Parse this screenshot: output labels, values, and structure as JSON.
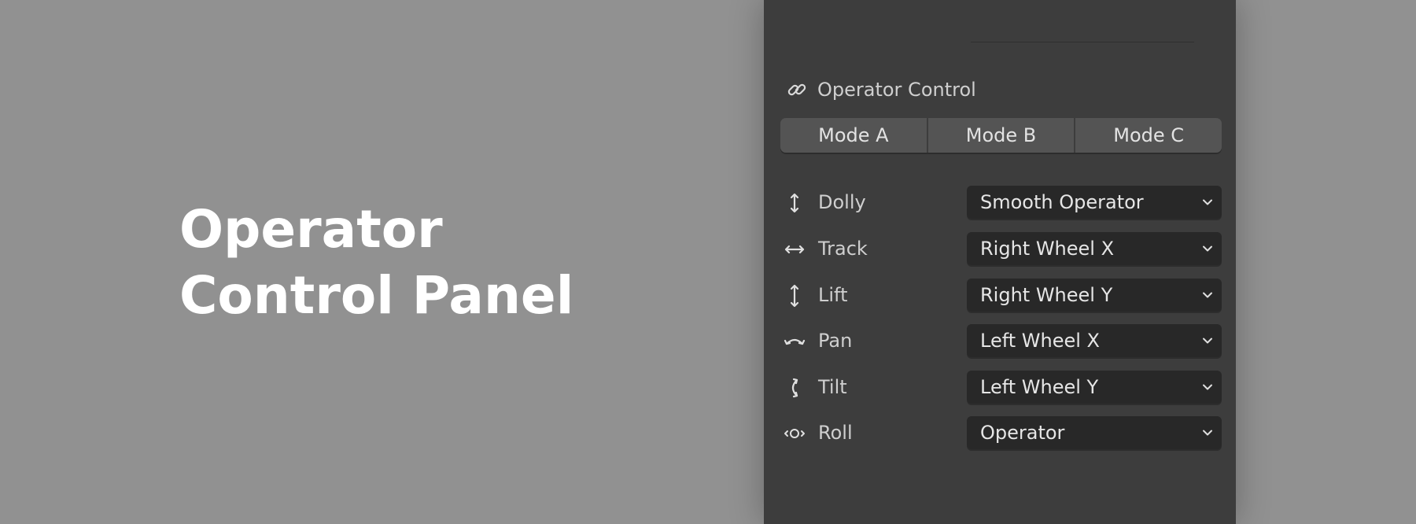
{
  "hero": {
    "line1": "Operator",
    "line2": "Control Panel"
  },
  "panel": {
    "section_title": "Operator Control",
    "section_icon": "link-icon",
    "modes": [
      "Mode A",
      "Mode B",
      "Mode C"
    ],
    "rows": [
      {
        "label": "Dolly",
        "icon": "vertical-arrow-icon",
        "value": "Smooth Operator"
      },
      {
        "label": "Track",
        "icon": "horizontal-arrow-icon",
        "value": "Right Wheel X"
      },
      {
        "label": "Lift",
        "icon": "vertical-arrow-icon",
        "value": "Right Wheel Y"
      },
      {
        "label": "Pan",
        "icon": "pan-arc-arrow-icon",
        "value": "Left Wheel X"
      },
      {
        "label": "Tilt",
        "icon": "tilt-arc-arrow-icon",
        "value": "Left Wheel Y"
      },
      {
        "label": "Roll",
        "icon": "roll-arrows-icon",
        "value": "Operator"
      }
    ]
  },
  "colors": {
    "background": "#919191",
    "panel": "#3d3d3d",
    "button": "#545454",
    "dropdown": "#282828",
    "text": "#cfcfcf"
  }
}
